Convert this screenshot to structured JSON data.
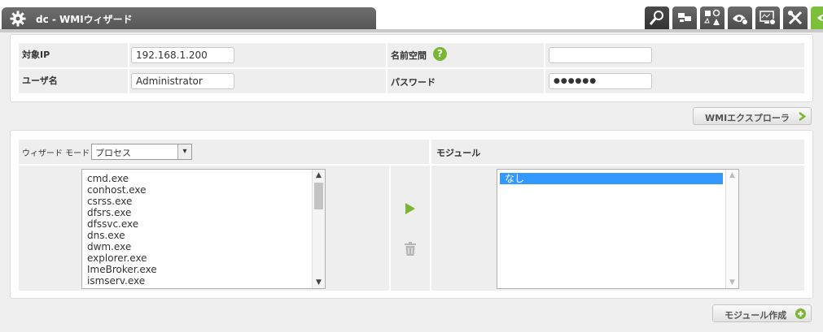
{
  "window": {
    "title": "dc - WMIウィザード",
    "icon": "gear-icon"
  },
  "toolbar": {
    "icons": [
      "search-icon",
      "network-icon",
      "shapes-icon",
      "eye-gear-icon",
      "monitor-gear-icon",
      "tools-icon",
      "eye-icon"
    ]
  },
  "form": {
    "target_ip_label": "対象IP",
    "target_ip_value": "192.168.1.200",
    "namespace_label": "名前空間",
    "namespace_value": "",
    "help_glyph": "?",
    "username_label": "ユーザ名",
    "username_value": "Administrator",
    "password_label": "パスワード",
    "password_value": "●●●●●●"
  },
  "explorer_button": "WMIエクスプローラ",
  "wizard": {
    "mode_label": "ウィザード モード :",
    "mode_value": "プロセス",
    "processes": [
      "cmd.exe",
      "conhost.exe",
      "csrss.exe",
      "dfsrs.exe",
      "dfssvc.exe",
      "dns.exe",
      "dwm.exe",
      "explorer.exe",
      "ImeBroker.exe",
      "ismserv.exe"
    ]
  },
  "module": {
    "header": "モジュール",
    "items": [
      "なし"
    ],
    "selected_index": 0
  },
  "create_module_button": "モジュール作成",
  "colors": {
    "accent_green": "#7ab534",
    "selection_blue": "#3399ff"
  }
}
